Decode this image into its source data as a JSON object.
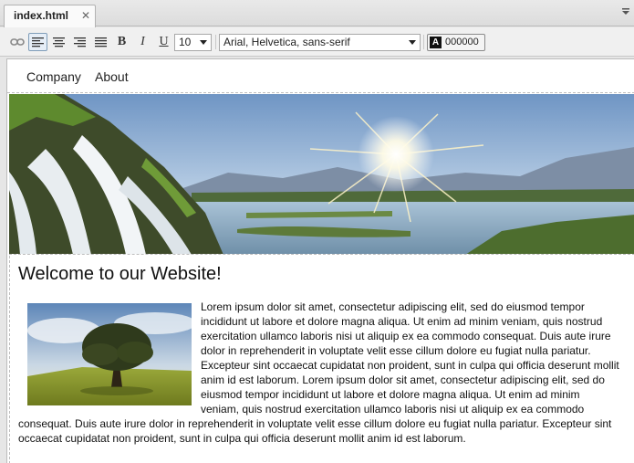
{
  "tab": {
    "title": "index.html",
    "close_glyph": "✕"
  },
  "toolbar": {
    "bold_label": "B",
    "italic_label": "I",
    "underline_label": "U",
    "font_size": "10",
    "font_family": "Arial, Helvetica, sans-serif",
    "text_color_label": "A",
    "text_color_hex": "000000",
    "icons": [
      "link-icon",
      "align-left-icon",
      "align-center-icon",
      "align-right-icon",
      "align-justify-icon"
    ]
  },
  "nav": {
    "items": [
      "Company",
      "About"
    ]
  },
  "page": {
    "heading": "Welcome to our Website!",
    "paragraph": "Lorem ipsum dolor sit amet, consectetur adipiscing elit, sed do eiusmod tempor incididunt ut labore et dolore magna aliqua. Ut enim ad minim veniam, quis nostrud exercitation ullamco laboris nisi ut aliquip ex ea commodo consequat. Duis aute irure dolor in reprehenderit in voluptate velit esse cillum dolore eu fugiat nulla pariatur. Excepteur sint occaecat cupidatat non proident, sunt in culpa qui officia deserunt mollit anim id est laborum. Lorem ipsum dolor sit amet, consectetur adipiscing elit, sed do eiusmod tempor incididunt ut labore et dolore magna aliqua. Ut enim ad minim veniam, quis nostrud exercitation ullamco laboris nisi ut aliquip ex ea commodo consequat. Duis aute irure dolor in reprehenderit in voluptate velit esse cillum dolore eu fugiat nulla pariatur. Excepteur sint occaecat cupidatat non proident, sunt in culpa qui officia deserunt mollit anim id est laborum."
  },
  "colors": {
    "accent": "#7f9db9",
    "text": "#111111"
  }
}
